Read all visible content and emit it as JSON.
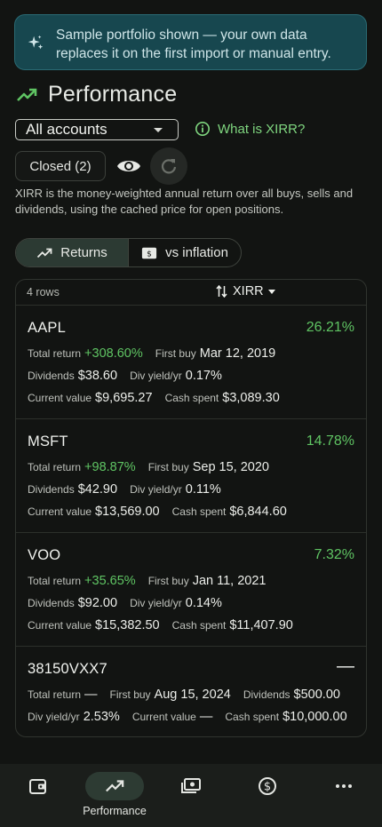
{
  "banner": {
    "icon": "sparkle-icon",
    "text": "Sample portfolio shown — your own data replaces it on the first import or manual entry."
  },
  "header": {
    "title": "Performance",
    "icon": "trending-up-icon"
  },
  "filters": {
    "account_selected": "All accounts",
    "xirr_help": "What is XIRR?",
    "closed_label": "Closed (2)"
  },
  "description": "XIRR is the money-weighted annual return over all buys, sells and dividends, using the cached price for open positions.",
  "tabs": [
    {
      "label": "Returns",
      "active": true,
      "icon": "trending-up-icon"
    },
    {
      "label": "vs inflation",
      "active": false,
      "icon": "cash-icon"
    }
  ],
  "table": {
    "row_count": "4 rows",
    "sort_label": "XIRR",
    "rows": [
      {
        "symbol": "AAPL",
        "xirr": "26.21%",
        "total_return_label": "Total return",
        "total_return": "+308.60%",
        "first_buy_label": "First buy",
        "first_buy": "Mar 12, 2019",
        "dividends_label": "Dividends",
        "dividends": "$38.60",
        "div_yield_label": "Div yield/yr",
        "div_yield": "0.17%",
        "current_value_label": "Current value",
        "current_value": "$9,695.27",
        "cash_spent_label": "Cash spent",
        "cash_spent": "$3,089.30"
      },
      {
        "symbol": "MSFT",
        "xirr": "14.78%",
        "total_return_label": "Total return",
        "total_return": "+98.87%",
        "first_buy_label": "First buy",
        "first_buy": "Sep 15, 2020",
        "dividends_label": "Dividends",
        "dividends": "$42.90",
        "div_yield_label": "Div yield/yr",
        "div_yield": "0.11%",
        "current_value_label": "Current value",
        "current_value": "$13,569.00",
        "cash_spent_label": "Cash spent",
        "cash_spent": "$6,844.60"
      },
      {
        "symbol": "VOO",
        "xirr": "7.32%",
        "total_return_label": "Total return",
        "total_return": "+35.65%",
        "first_buy_label": "First buy",
        "first_buy": "Jan 11, 2021",
        "dividends_label": "Dividends",
        "dividends": "$92.00",
        "div_yield_label": "Div yield/yr",
        "div_yield": "0.14%",
        "current_value_label": "Current value",
        "current_value": "$15,382.50",
        "cash_spent_label": "Cash spent",
        "cash_spent": "$11,407.90"
      },
      {
        "symbol": "38150VXX7",
        "xirr": "—",
        "total_return_label": "Total return",
        "total_return": "—",
        "first_buy_label": "First buy",
        "first_buy": "Aug 15, 2024",
        "dividends_label": "Dividends",
        "dividends": "$500.00",
        "div_yield_label": "Div yield/yr",
        "div_yield": "2.53%",
        "current_value_label": "Current value",
        "current_value": "—",
        "cash_spent_label": "Cash spent",
        "cash_spent": "$10,000.00"
      }
    ]
  },
  "nav": [
    {
      "icon": "wallet-icon",
      "label": ""
    },
    {
      "icon": "trending-up-icon",
      "label": "Performance",
      "active": true
    },
    {
      "icon": "cash-icon",
      "label": ""
    },
    {
      "icon": "dollar-circle-icon",
      "label": ""
    },
    {
      "icon": "more-icon",
      "label": ""
    }
  ],
  "colors": {
    "accent_green": "#5fc463",
    "banner_bg": "#17474f",
    "background": "#121412"
  }
}
